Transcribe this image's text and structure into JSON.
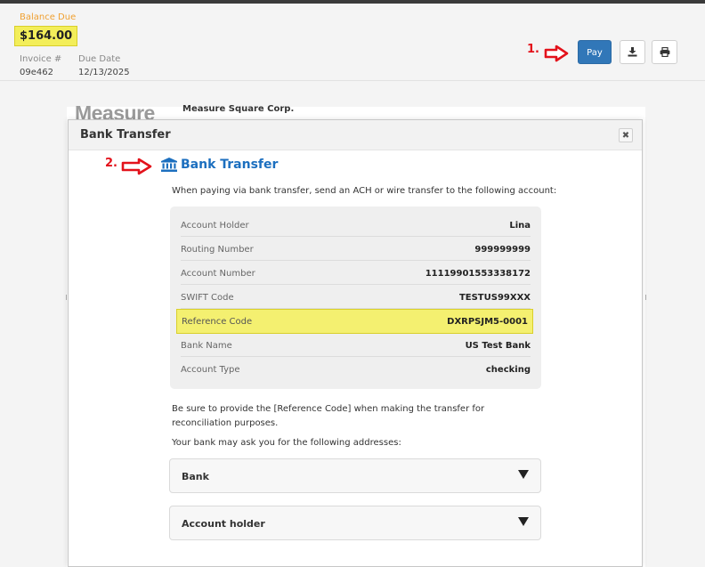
{
  "header": {
    "balance_label": "Balance Due",
    "balance_amount": "$164.00",
    "invoice_label": "Invoice #",
    "invoice_value": "09e462",
    "due_label": "Due Date",
    "due_value": "12/13/2025"
  },
  "annotations": {
    "step1": "1.",
    "step2": "2."
  },
  "toolbar": {
    "pay_label": "Pay",
    "download_icon": "download-icon",
    "print_icon": "printer-icon"
  },
  "document": {
    "logo_text": "Measure",
    "company_name": "Measure Square Corp."
  },
  "modal": {
    "title": "Bank Transfer",
    "close_symbol": "✖",
    "heading": "Bank Transfer",
    "heading_icon": "bank-icon",
    "intro": "When paying via bank transfer, send an ACH or wire transfer to the following account:",
    "rows": [
      {
        "label": "Account Holder",
        "value": "Lina"
      },
      {
        "label": "Routing Number",
        "value": "999999999"
      },
      {
        "label": "Account Number",
        "value": "11119901553338172"
      },
      {
        "label": "SWIFT Code",
        "value": "TESTUS99XXX"
      },
      {
        "label": "Reference Code",
        "value": "DXRPSJM5-0001"
      },
      {
        "label": "Bank Name",
        "value": "US Test Bank"
      },
      {
        "label": "Account Type",
        "value": "checking"
      }
    ],
    "note": "Be sure to provide the [Reference Code] when making the transfer for reconciliation purposes.",
    "addresses_prompt": "Your bank may ask you for the following addresses:",
    "sections": [
      {
        "label": "Bank"
      },
      {
        "label": "Account holder"
      }
    ]
  },
  "colors": {
    "accent_blue": "#1c6fbf",
    "pay_button": "#3177b8",
    "highlight_yellow": "#f4f070",
    "annotation_red": "#e3121b",
    "balance_label_orange": "#f0a030"
  }
}
